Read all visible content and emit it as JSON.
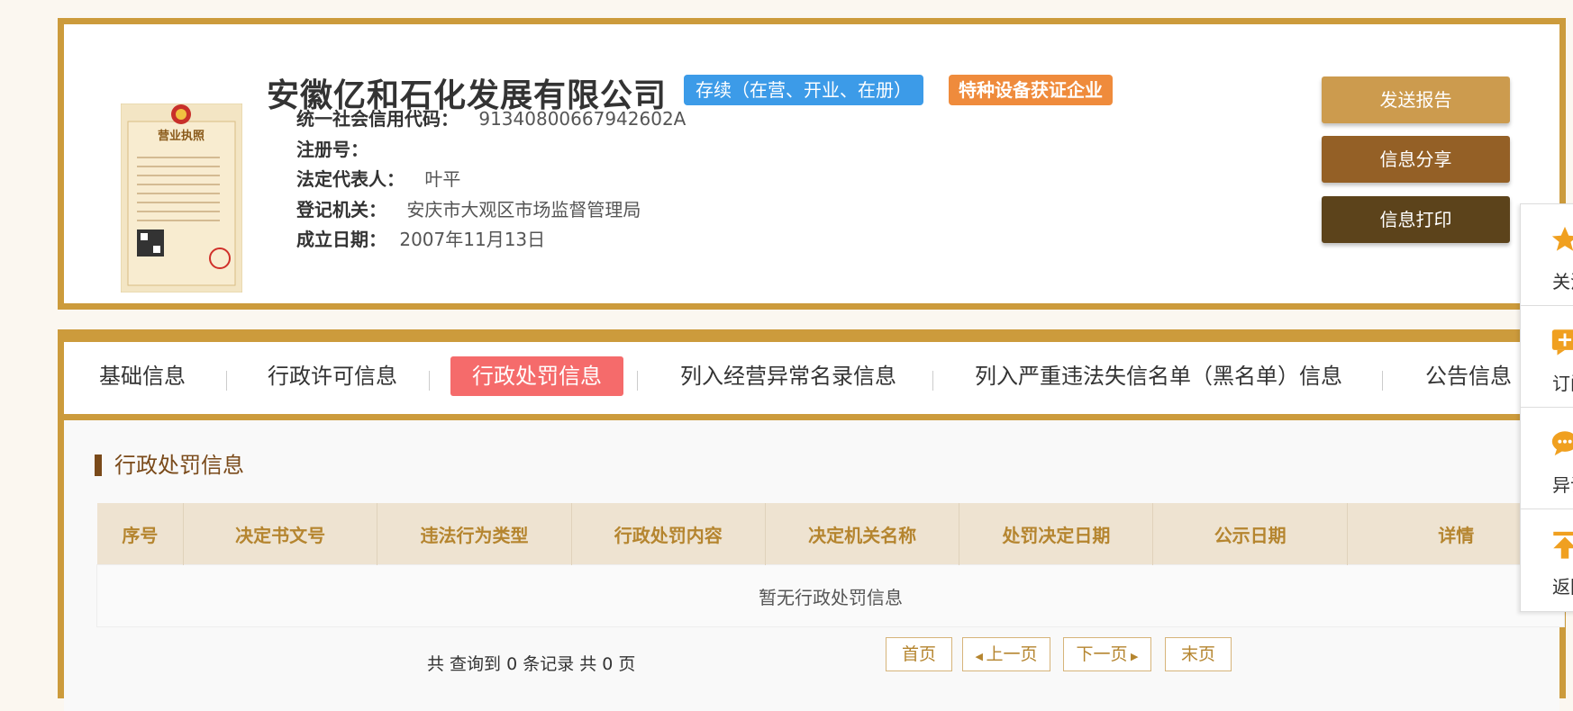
{
  "company": {
    "name": "安徽亿和石化发展有限公司",
    "status_badge": "存续（在营、开业、在册）",
    "special_badge": "特种设备获证企业",
    "fields": [
      {
        "label": "统一社会信用代码：",
        "value": "91340800667942602A"
      },
      {
        "label": "注册号：",
        "value": ""
      },
      {
        "label": "法定代表人：",
        "value": "叶平"
      },
      {
        "label": "登记机关：",
        "value": "安庆市大观区市场监督管理局"
      },
      {
        "label": "成立日期：",
        "value": "2007年11月13日"
      }
    ],
    "license_title": "营业执照"
  },
  "actions": {
    "send_report": "发送报告",
    "share": "信息分享",
    "print": "信息打印"
  },
  "tabs": [
    {
      "label": "基础信息"
    },
    {
      "label": "行政许可信息"
    },
    {
      "label": "行政处罚信息",
      "active": true
    },
    {
      "label": "列入经营异常名录信息"
    },
    {
      "label": "列入严重违法失信名单（黑名单）信息"
    },
    {
      "label": "公告信息"
    }
  ],
  "section": {
    "title": "行政处罚信息",
    "columns": [
      "序号",
      "决定书文号",
      "违法行为类型",
      "行政处罚内容",
      "决定机关名称",
      "处罚决定日期",
      "公示日期",
      "详情"
    ],
    "empty_text": "暂无行政处罚信息",
    "summary": "共 查询到 0 条记录 共 0 页"
  },
  "pagination": {
    "first": "首页",
    "prev": "上一页",
    "next": "下一页",
    "last": "末页"
  },
  "float_bar": [
    {
      "label": "关注",
      "icon": "star-icon"
    },
    {
      "label": "订阅",
      "icon": "subscribe-icon"
    },
    {
      "label": "异议",
      "icon": "chat-icon"
    },
    {
      "label": "返回",
      "icon": "arrow-up-icon"
    }
  ],
  "colors": {
    "gold": "#cc9b3c",
    "active_tab": "#f56b6b",
    "status_blue": "#3c9be8",
    "special_orange": "#ef8b3c"
  }
}
